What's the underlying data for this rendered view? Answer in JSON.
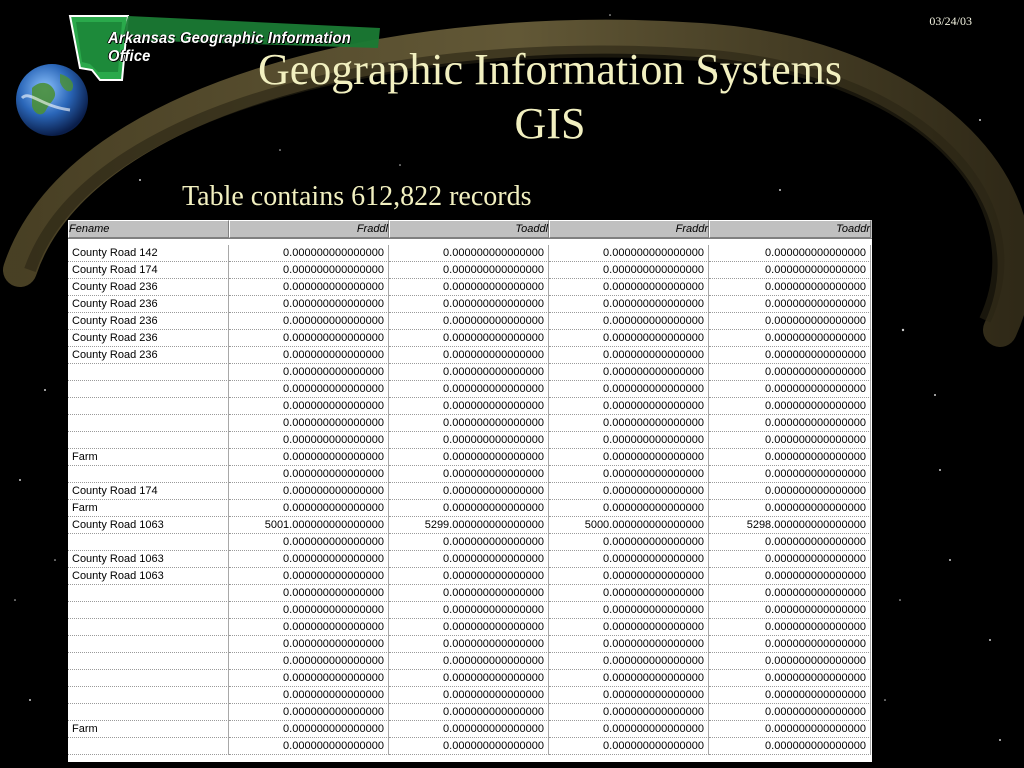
{
  "date": "03/24/03",
  "logo": {
    "text": "Arkansas Geographic Information Office"
  },
  "title": "Geographic Information Systems",
  "subtitle": "GIS",
  "caption": "Table contains 612,822 records",
  "table": {
    "columns": [
      "Fename",
      "Fraddl",
      "Toaddl",
      "Fraddr",
      "Toaddr"
    ],
    "rows": [
      [
        "County Road 142",
        "0.000000000000000",
        "0.000000000000000",
        "0.000000000000000",
        "0.000000000000000"
      ],
      [
        "County Road 174",
        "0.000000000000000",
        "0.000000000000000",
        "0.000000000000000",
        "0.000000000000000"
      ],
      [
        "County Road 236",
        "0.000000000000000",
        "0.000000000000000",
        "0.000000000000000",
        "0.000000000000000"
      ],
      [
        "County Road 236",
        "0.000000000000000",
        "0.000000000000000",
        "0.000000000000000",
        "0.000000000000000"
      ],
      [
        "County Road 236",
        "0.000000000000000",
        "0.000000000000000",
        "0.000000000000000",
        "0.000000000000000"
      ],
      [
        "County Road 236",
        "0.000000000000000",
        "0.000000000000000",
        "0.000000000000000",
        "0.000000000000000"
      ],
      [
        "County Road 236",
        "0.000000000000000",
        "0.000000000000000",
        "0.000000000000000",
        "0.000000000000000"
      ],
      [
        "",
        "0.000000000000000",
        "0.000000000000000",
        "0.000000000000000",
        "0.000000000000000"
      ],
      [
        "",
        "0.000000000000000",
        "0.000000000000000",
        "0.000000000000000",
        "0.000000000000000"
      ],
      [
        "",
        "0.000000000000000",
        "0.000000000000000",
        "0.000000000000000",
        "0.000000000000000"
      ],
      [
        "",
        "0.000000000000000",
        "0.000000000000000",
        "0.000000000000000",
        "0.000000000000000"
      ],
      [
        "",
        "0.000000000000000",
        "0.000000000000000",
        "0.000000000000000",
        "0.000000000000000"
      ],
      [
        "Farm",
        "0.000000000000000",
        "0.000000000000000",
        "0.000000000000000",
        "0.000000000000000"
      ],
      [
        "",
        "0.000000000000000",
        "0.000000000000000",
        "0.000000000000000",
        "0.000000000000000"
      ],
      [
        "County Road 174",
        "0.000000000000000",
        "0.000000000000000",
        "0.000000000000000",
        "0.000000000000000"
      ],
      [
        "Farm",
        "0.000000000000000",
        "0.000000000000000",
        "0.000000000000000",
        "0.000000000000000"
      ],
      [
        "County Road 1063",
        "5001.000000000000000",
        "5299.000000000000000",
        "5000.000000000000000",
        "5298.000000000000000"
      ],
      [
        "",
        "0.000000000000000",
        "0.000000000000000",
        "0.000000000000000",
        "0.000000000000000"
      ],
      [
        "County Road 1063",
        "0.000000000000000",
        "0.000000000000000",
        "0.000000000000000",
        "0.000000000000000"
      ],
      [
        "County Road 1063",
        "0.000000000000000",
        "0.000000000000000",
        "0.000000000000000",
        "0.000000000000000"
      ],
      [
        "",
        "0.000000000000000",
        "0.000000000000000",
        "0.000000000000000",
        "0.000000000000000"
      ],
      [
        "",
        "0.000000000000000",
        "0.000000000000000",
        "0.000000000000000",
        "0.000000000000000"
      ],
      [
        "",
        "0.000000000000000",
        "0.000000000000000",
        "0.000000000000000",
        "0.000000000000000"
      ],
      [
        "",
        "0.000000000000000",
        "0.000000000000000",
        "0.000000000000000",
        "0.000000000000000"
      ],
      [
        "",
        "0.000000000000000",
        "0.000000000000000",
        "0.000000000000000",
        "0.000000000000000"
      ],
      [
        "",
        "0.000000000000000",
        "0.000000000000000",
        "0.000000000000000",
        "0.000000000000000"
      ],
      [
        "",
        "0.000000000000000",
        "0.000000000000000",
        "0.000000000000000",
        "0.000000000000000"
      ],
      [
        "",
        "0.000000000000000",
        "0.000000000000000",
        "0.000000000000000",
        "0.000000000000000"
      ],
      [
        "Farm",
        "0.000000000000000",
        "0.000000000000000",
        "0.000000000000000",
        "0.000000000000000"
      ],
      [
        "",
        "0.000000000000000",
        "0.000000000000000",
        "0.000000000000000",
        "0.000000000000000"
      ]
    ]
  },
  "colors": {
    "background": "#000000",
    "title_text": "#f2f0c0",
    "table_header": "#c0c0c0",
    "orbit": "#8a7a45"
  }
}
